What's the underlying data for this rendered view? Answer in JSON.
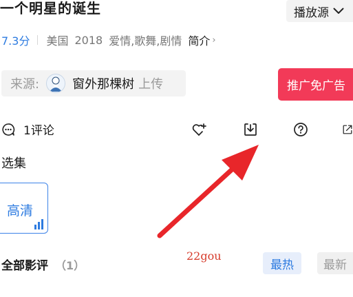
{
  "header": {
    "title": "一个明星的诞生",
    "source_select_label": "播放源"
  },
  "meta": {
    "score": "7.3分",
    "country": "美国",
    "year": "2018",
    "genres": "爱情,歌舞,剧情",
    "intro_link": "简介",
    "intro_arrow": "›"
  },
  "uploader": {
    "label": "来源:",
    "name": "窗外那棵树",
    "suffix": "上传"
  },
  "promo_button": "推广免广告",
  "actions": {
    "comment_count": "1评论",
    "icons": [
      "comment-icon",
      "heart-add-icon",
      "download-icon",
      "help-icon",
      "share-icon"
    ]
  },
  "episodes": {
    "section_title": "选集",
    "items": [
      {
        "label": "高清"
      }
    ]
  },
  "reviews": {
    "title": "全部影评",
    "count": "（1）",
    "sort_hot": "最热",
    "sort_new": "最新"
  },
  "watermark": "22gou",
  "colors": {
    "accent_blue": "#2d7be0",
    "promo_red": "#f23a58",
    "annotation_arrow": "#e8262a"
  }
}
